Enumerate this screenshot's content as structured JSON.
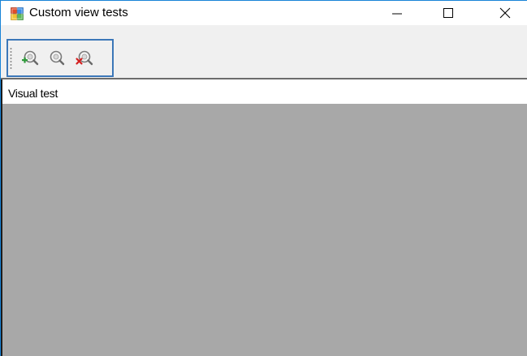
{
  "window": {
    "title": "Custom view tests",
    "accent_color": "#1883d7"
  },
  "title_bar": {
    "icons": {
      "app": "app-window-icon",
      "minimize": "minimize-icon",
      "maximize": "maximize-icon",
      "close": "close-icon"
    }
  },
  "toolbar": {
    "buttons": [
      {
        "name": "zoom-in",
        "icon": "zoom-in-icon"
      },
      {
        "name": "zoom-reset",
        "icon": "zoom-reset-icon"
      },
      {
        "name": "zoom-cancel",
        "icon": "zoom-cancel-icon"
      }
    ],
    "border_color": "#3c77b8"
  },
  "view": {
    "header_label": "Visual test",
    "background_color": "#a8a8a8"
  }
}
